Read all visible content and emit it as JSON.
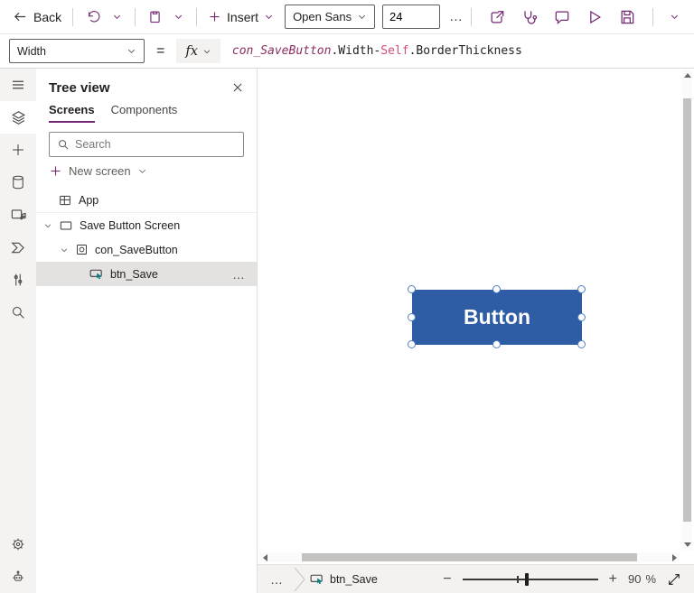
{
  "topbar": {
    "back_label": "Back",
    "insert_label": "Insert",
    "font_family_value": "Open Sans",
    "font_size_value": "24",
    "overflow_label": "…"
  },
  "formula_bar": {
    "property_value": "Width",
    "equals_sign": "=",
    "fx_label": "fx",
    "formula_parts": [
      {
        "text": "con_SaveButton",
        "token": "control"
      },
      {
        "text": ".Width-",
        "token": "plain"
      },
      {
        "text": "Self",
        "token": "keyword"
      },
      {
        "text": ".BorderThickness",
        "token": "plain"
      }
    ]
  },
  "left_rail": {
    "items": [
      "menu",
      "tree-view",
      "insert",
      "data",
      "media",
      "power-automate",
      "advanced-tools",
      "search"
    ],
    "bottom_items": [
      "settings",
      "virtual-agent"
    ]
  },
  "tree_view": {
    "title": "Tree view",
    "tabs": [
      {
        "label": "Screens",
        "active": true
      },
      {
        "label": "Components",
        "active": false
      }
    ],
    "search_placeholder": "Search",
    "new_screen_label": "New screen",
    "items": [
      {
        "label": "App",
        "type": "app"
      },
      {
        "label": "Save Button Screen",
        "type": "screen",
        "expanded": true
      },
      {
        "label": "con_SaveButton",
        "type": "container",
        "expanded": true
      },
      {
        "label": "btn_Save",
        "type": "button",
        "selected": true,
        "overflow_label": "…"
      }
    ]
  },
  "canvas": {
    "button_label": "Button",
    "button_fill": "#2e5da6"
  },
  "status_bar": {
    "overflow_label": "…",
    "selected_control_label": "btn_Save",
    "zoom_minus_label": "−",
    "zoom_plus_label": "+",
    "zoom_value": "90",
    "zoom_percent_sign": "%"
  },
  "colors": {
    "accent": "#742774",
    "button_fill": "#2e5da6",
    "selection_handle_border": "#4f7fc4",
    "pointer_teal": "#038387"
  }
}
